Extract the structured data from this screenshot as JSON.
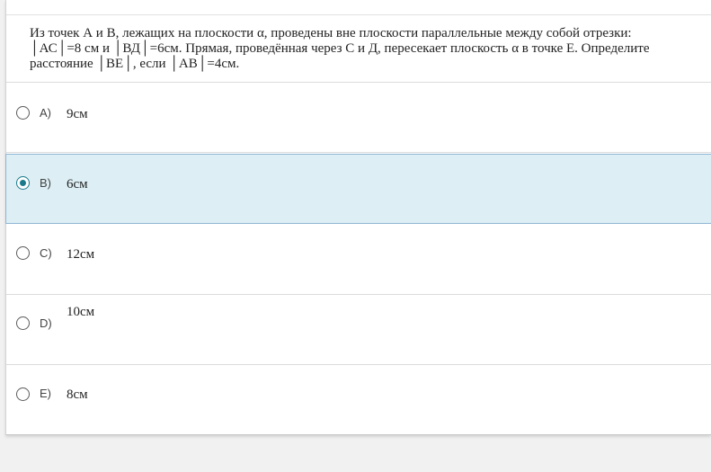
{
  "question": {
    "text": "Из точек А и В, лежащих на плоскости α, проведены вне плоскости параллельные между собой отрезки: │АС│=8 см и │ВД│=6см.  Прямая, проведённая через С и Д, пересекает плоскость α в точке Е. Определите расстояние │ВЕ│, если │АВ│=4см."
  },
  "options": [
    {
      "letter": "A)",
      "value": "9см",
      "selected": false
    },
    {
      "letter": "B)",
      "value": "6см",
      "selected": true
    },
    {
      "letter": "C)",
      "value": "12см",
      "selected": false
    },
    {
      "letter": "D)",
      "value": "10см",
      "selected": false
    },
    {
      "letter": "E)",
      "value": "8см",
      "selected": false
    }
  ],
  "colors": {
    "selected_bg": "#ddeff5",
    "selected_border": "#8fb6d4",
    "radio_accent": "#1a7a8c"
  }
}
